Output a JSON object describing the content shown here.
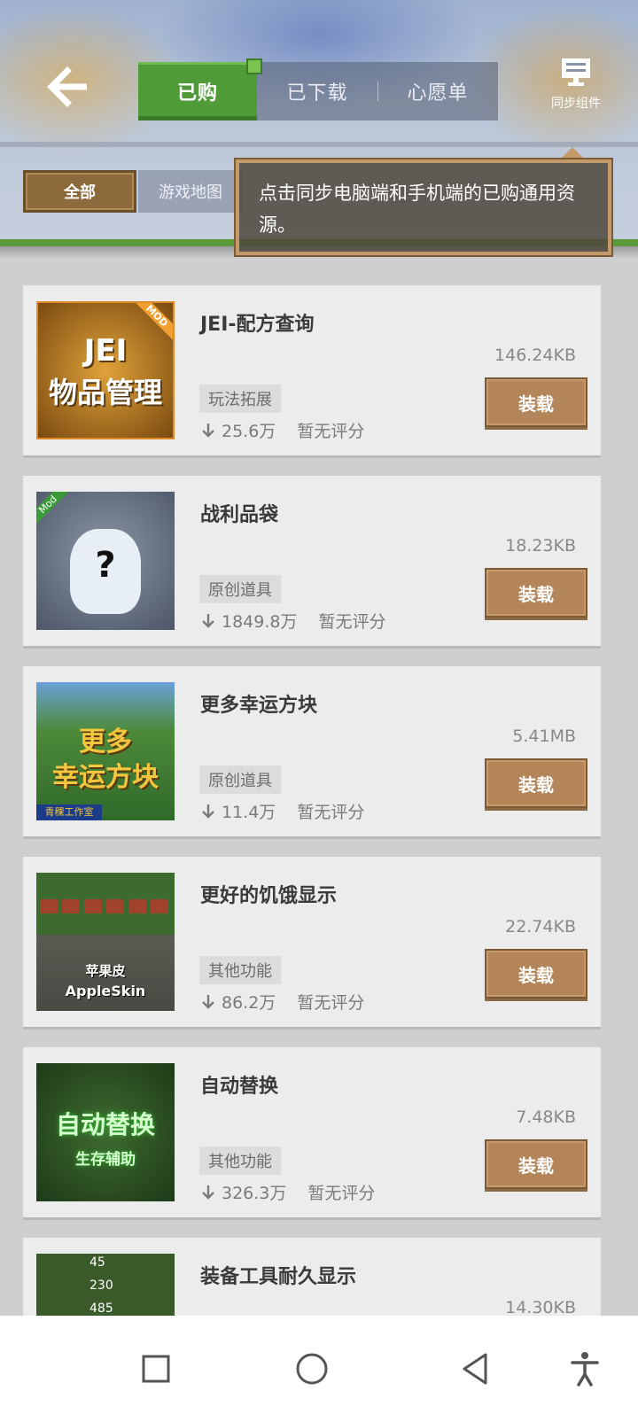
{
  "header": {
    "tabs": [
      {
        "label": "已购",
        "active": true
      },
      {
        "label": "已下载",
        "active": false
      },
      {
        "label": "心愿单",
        "active": false
      }
    ],
    "sync_label": "同步组件",
    "icons": {
      "back": "back-arrow-icon",
      "sync": "sync-monitor-icon"
    }
  },
  "filters": {
    "all": "全部",
    "map": "游戏地图"
  },
  "tooltip": {
    "text": "点击同步电脑端和手机端的已购通用资源。"
  },
  "items": [
    {
      "title": "JEI-配方查询",
      "size": "146.24KB",
      "tag": "玩法拓展",
      "downloads": "25.6万",
      "rating": "暂无评分",
      "button": "装载",
      "thumb": {
        "badge": "MOD",
        "line1": "JEI",
        "line2": "物品管理"
      }
    },
    {
      "title": "战利品袋",
      "size": "18.23KB",
      "tag": "原创道具",
      "downloads": "1849.8万",
      "rating": "暂无评分",
      "button": "装载",
      "thumb": {
        "badge": "Mod",
        "line1": "?",
        "line2": ""
      }
    },
    {
      "title": "更多幸运方块",
      "size": "5.41MB",
      "tag": "原创道具",
      "downloads": "11.4万",
      "rating": "暂无评分",
      "button": "装载",
      "thumb": {
        "badge": "",
        "line1": "更多",
        "line2": "幸运方块",
        "footer": "青稞工作室"
      }
    },
    {
      "title": "更好的饥饿显示",
      "size": "22.74KB",
      "tag": "其他功能",
      "downloads": "86.2万",
      "rating": "暂无评分",
      "button": "装载",
      "thumb": {
        "badge": "",
        "line1": "苹果皮",
        "line2": "AppleSkin"
      }
    },
    {
      "title": "自动替换",
      "size": "7.48KB",
      "tag": "其他功能",
      "downloads": "326.3万",
      "rating": "暂无评分",
      "button": "装载",
      "thumb": {
        "badge": "",
        "line1": "自动替换",
        "line2": "生存辅助"
      }
    },
    {
      "title": "装备工具耐久显示",
      "size": "14.30KB",
      "tag": "",
      "downloads": "",
      "rating": "",
      "button": "",
      "thumb": {
        "badge": "",
        "line1": "45",
        "line2": "230",
        "line3": "485"
      }
    }
  ],
  "colors": {
    "accent_green": "#4f9b38",
    "button_brown": "#b38558",
    "filter_brown": "#8c6a3c"
  }
}
